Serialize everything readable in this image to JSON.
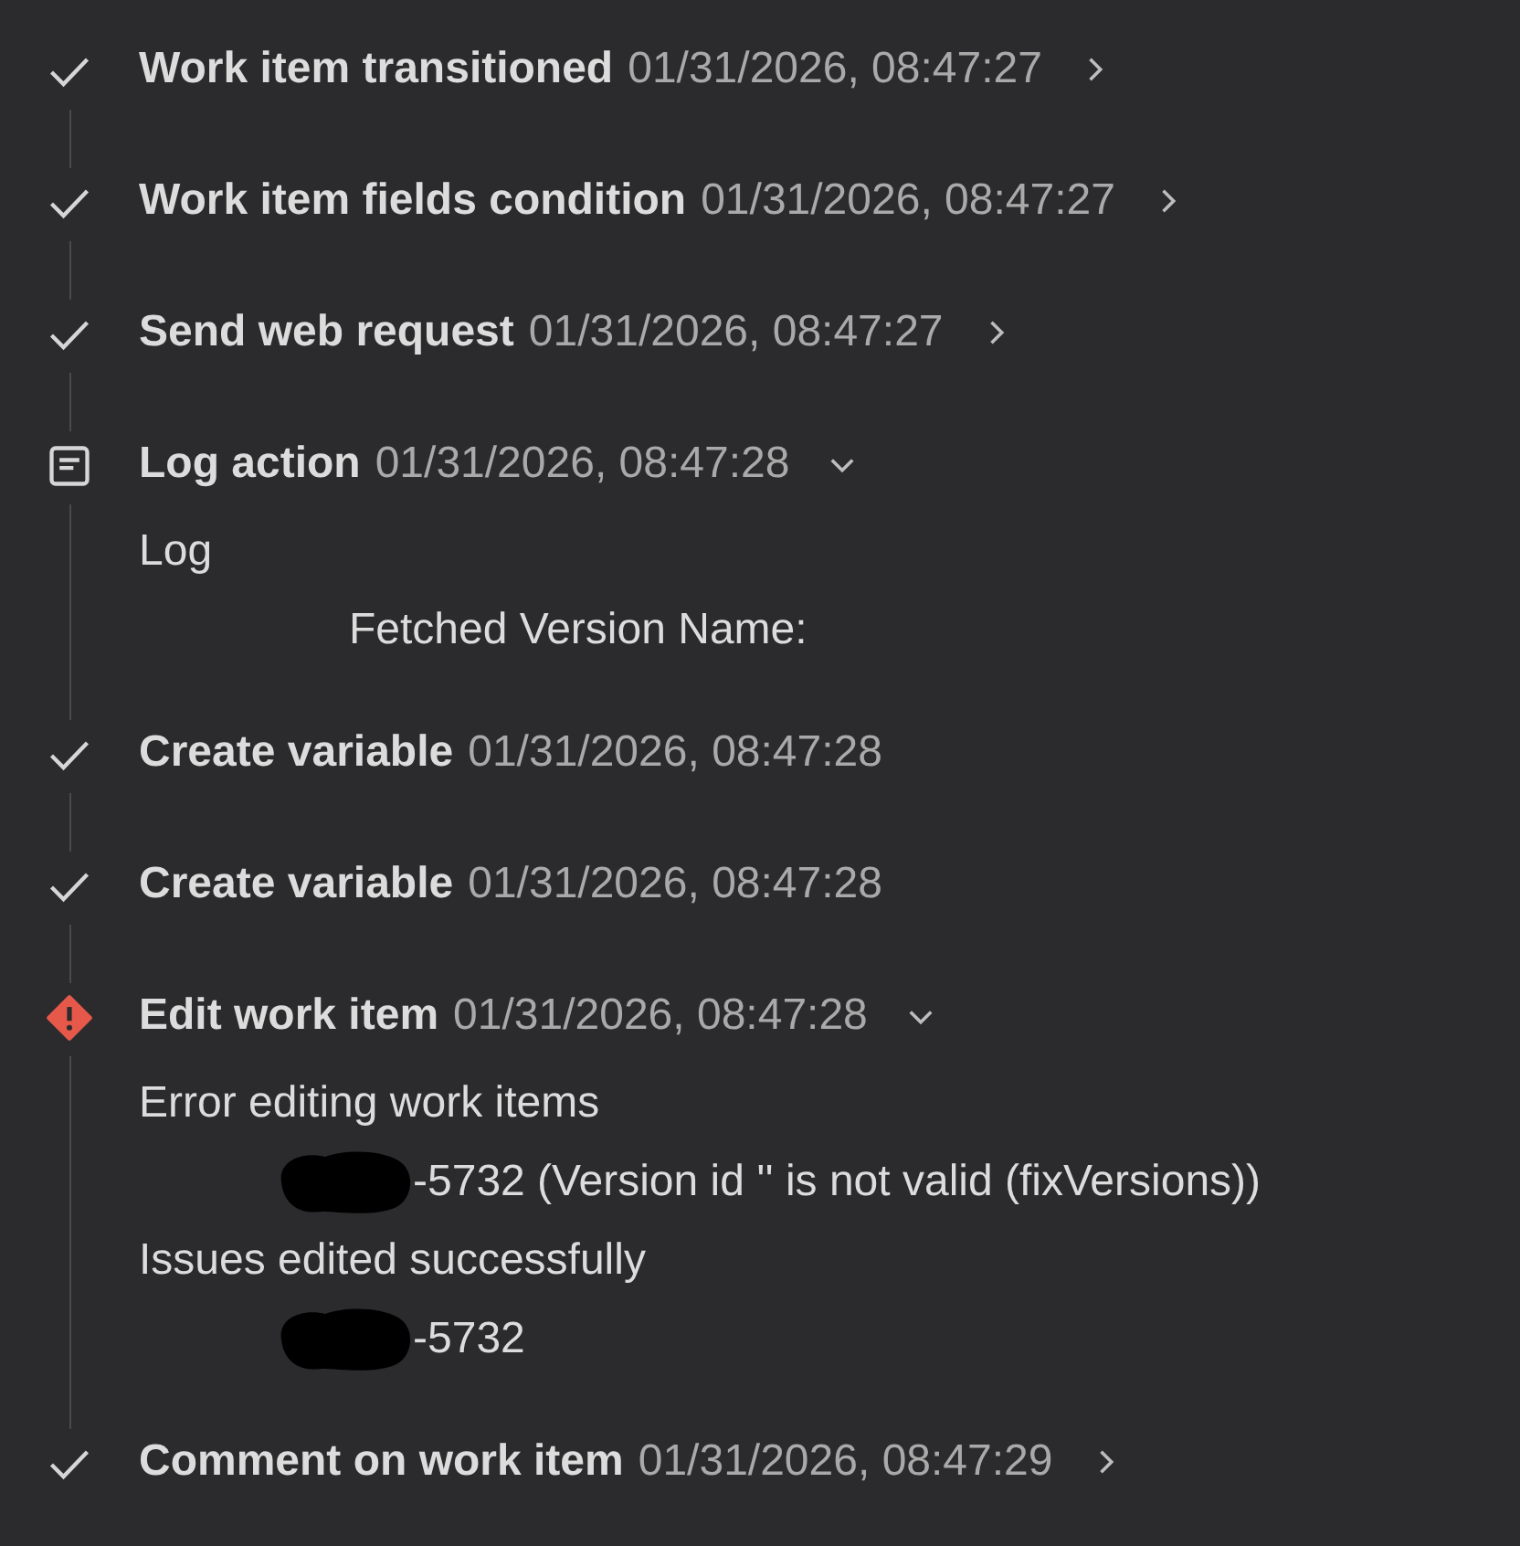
{
  "steps": [
    {
      "kind": "success",
      "title": "Work item transitioned",
      "time": "01/31/2026, 08:47:27",
      "expanded": false
    },
    {
      "kind": "success",
      "title": "Work item fields condition",
      "time": "01/31/2026, 08:47:27",
      "expanded": false
    },
    {
      "kind": "success",
      "title": "Send web request",
      "time": "01/31/2026, 08:47:27",
      "expanded": false
    },
    {
      "kind": "log",
      "title": "Log action",
      "time": "01/31/2026, 08:47:28",
      "expanded": true,
      "details": [
        {
          "kind": "heading",
          "text": "Log"
        },
        {
          "kind": "value",
          "text": "Fetched Version Name:"
        }
      ]
    },
    {
      "kind": "success",
      "title": "Create variable",
      "time": "01/31/2026, 08:47:28"
    },
    {
      "kind": "success",
      "title": "Create variable",
      "time": "01/31/2026, 08:47:28"
    },
    {
      "kind": "error",
      "title": "Edit work item",
      "time": "01/31/2026, 08:47:28",
      "expanded": true,
      "details": [
        {
          "kind": "heading",
          "text": "Error editing work items"
        },
        {
          "kind": "value",
          "text": "-5732 (Version id '' is not valid (fixVersions))",
          "redacted": true
        },
        {
          "kind": "heading",
          "text": "Issues edited successfully"
        },
        {
          "kind": "value",
          "text": "-5732",
          "redacted": true
        }
      ]
    },
    {
      "kind": "success",
      "title": "Comment on work item",
      "time": "01/31/2026, 08:47:29",
      "expanded": false
    }
  ]
}
